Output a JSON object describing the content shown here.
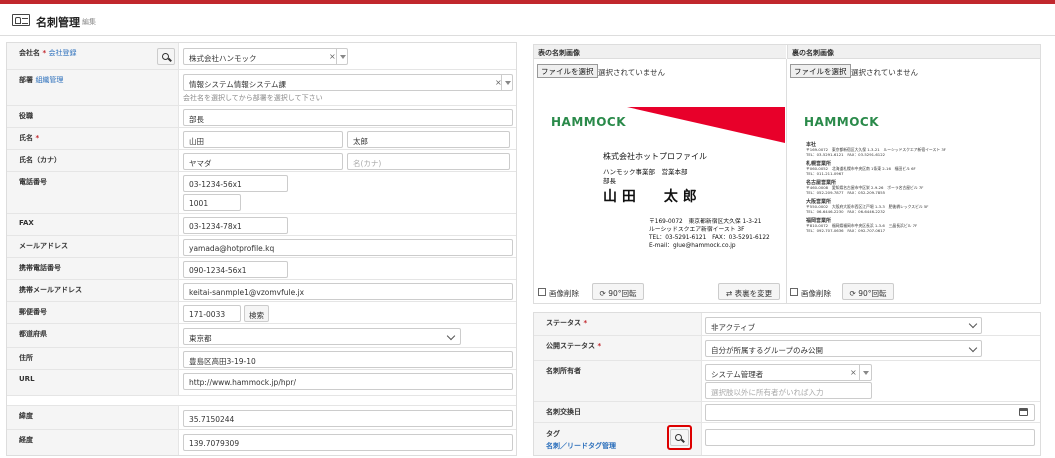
{
  "header": {
    "title": "名刺管理",
    "subtitle": "編集"
  },
  "left": {
    "company": {
      "label": "会社名",
      "link": "会社登録",
      "value": "株式会社ハンモック"
    },
    "department": {
      "label": "部署",
      "link": "組織管理",
      "value": "情報システム情報システム課",
      "hint": "会社名を選択してから部署を選択して下さい"
    },
    "position": {
      "label": "役職",
      "value": "部長"
    },
    "name": {
      "label": "氏名",
      "last": "山田",
      "first": "太郎"
    },
    "kana": {
      "label": "氏名（カナ）",
      "last": "ヤマダ",
      "first_placeholder": "名(カナ)"
    },
    "phone": {
      "label": "電話番号",
      "value": "03-1234-56x1",
      "ext": "1001"
    },
    "fax": {
      "label": "FAX",
      "value": "03-1234-78x1"
    },
    "email": {
      "label": "メールアドレス",
      "value": "yamada@hotprofile.kq"
    },
    "mobile": {
      "label": "携帯電話番号",
      "value": "090-1234-56x1"
    },
    "mobile_email": {
      "label": "携帯メールアドレス",
      "value": "keitai-sanmple1@vzomvfule.jx"
    },
    "zip": {
      "label": "郵便番号",
      "value": "171-0033",
      "button": "検索"
    },
    "prefecture": {
      "label": "都道府県",
      "value": "東京都"
    },
    "address": {
      "label": "住所",
      "value": "豊島区高田3-19-10"
    },
    "url": {
      "label": "URL",
      "value": "http://www.hammock.jp/hpr/"
    },
    "latitude": {
      "label": "緯度",
      "value": "35.7150244"
    },
    "longitude": {
      "label": "経度",
      "value": "139.7079309"
    }
  },
  "images": {
    "front": {
      "title": "表の名刺画像",
      "file_button": "ファイルを選択",
      "file_status": "選択されていません",
      "delete_label": "画像削除",
      "rotate_label": "90°回転",
      "swap_label": "表裏を変更"
    },
    "back": {
      "title": "裏の名刺画像",
      "file_button": "ファイルを選択",
      "file_status": "選択されていません",
      "delete_label": "画像削除",
      "rotate_label": "90°回転"
    }
  },
  "front_card": {
    "logo": "HAMMOCK",
    "company": "株式会社ホットプロファイル",
    "dept": "ハンモック事業部　営業本部",
    "title": "部長",
    "name": "山 田　　太 郎",
    "addr": "〒169-0072　東京都新宿区大久保 1-3-21",
    "bldg": "ルーシッドスクエア新宿イースト 3F",
    "tel": "TEL：03-5291-6121　FAX：03-5291-6122",
    "mail": "E-mail：glue@hammock.co.jp"
  },
  "back_card": {
    "logo": "HAMMOCK",
    "lines": [
      "本社",
      "〒169-0072　東京都新宿区大久保 1-3-21　ルーシッドスクエア新宿イースト 3F",
      "TEL：03-5291-6121　FAX：03-5291-6122",
      "札幌営業所",
      "〒060-0052　北海道札幌市中央区南 1条東 2-16　福田ビル 6F",
      "TEL：011-211-0967",
      "名古屋営業所",
      "〒460-0008　愛知県名古屋市中区栄 2-9-26　ポーラ名古屋ビル 7F",
      "TEL：052-209-7877　FAX：052-209-7855",
      "大阪営業所",
      "〒550-0002　大阪府大阪市西区江戸堀 1-3-3　肥後橋レックスビル 5F",
      "TEL：06-6446-2230　FAX：06-6446-2232",
      "福岡営業所",
      "〒810-0072　福岡県福岡市中央区長浜 1-3-6　三晶長浜ビル 7F",
      "TEL：092-707-0636　FAX：092-707-0617"
    ]
  },
  "right": {
    "status": {
      "label": "ステータス",
      "value": "非アクティブ"
    },
    "publish": {
      "label": "公開ステータス",
      "value": "自分が所属するグループのみ公開"
    },
    "owner": {
      "label": "名刺所有者",
      "value": "システム管理者",
      "placeholder": "選択肢以外に所有者がいれば入力"
    },
    "exchange": {
      "label": "名刺交換日",
      "value": ""
    },
    "tag": {
      "label": "タグ",
      "link": "名刺／リードタグ管理",
      "value": ""
    }
  },
  "colors": {
    "accent": "#c1272d",
    "link": "#2a6ebb",
    "highlight": "#dd0000",
    "logo_green": "#2a8a4a"
  }
}
